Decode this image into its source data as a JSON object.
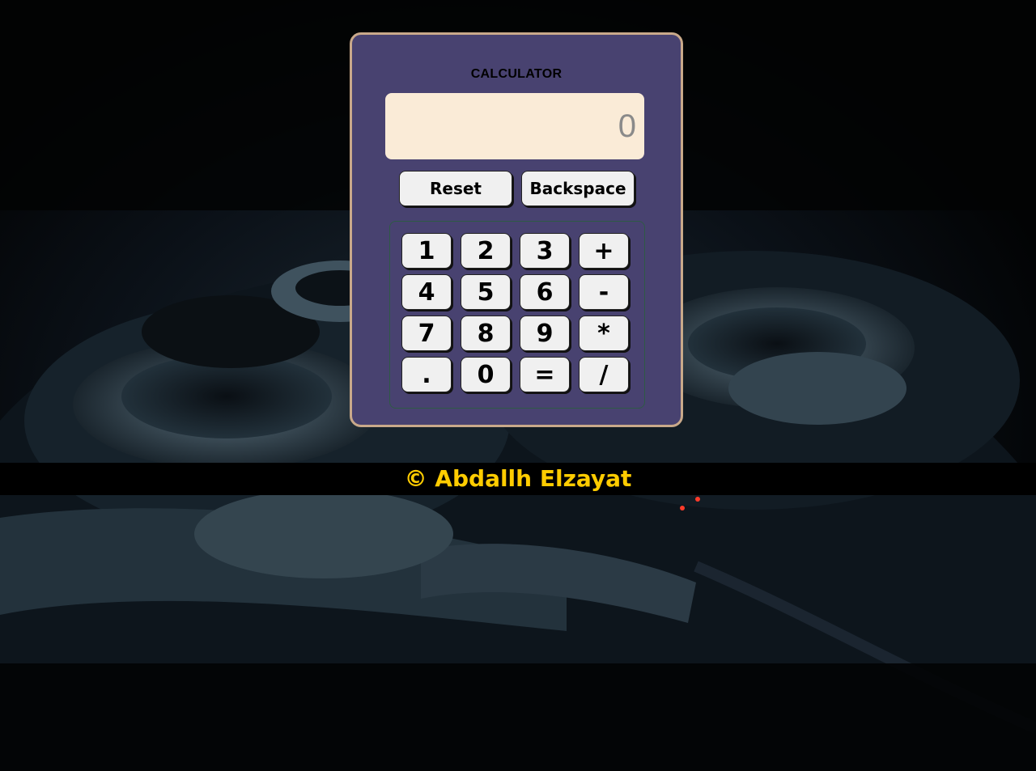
{
  "calculator": {
    "title": "CALCULATOR",
    "display_value": "",
    "display_placeholder": "0",
    "reset_label": "Reset",
    "backspace_label": "Backspace",
    "keys": [
      {
        "label": "1",
        "name": "key-1"
      },
      {
        "label": "2",
        "name": "key-2"
      },
      {
        "label": "3",
        "name": "key-3"
      },
      {
        "label": "+",
        "name": "key-plus"
      },
      {
        "label": "4",
        "name": "key-4"
      },
      {
        "label": "5",
        "name": "key-5"
      },
      {
        "label": "6",
        "name": "key-6"
      },
      {
        "label": "-",
        "name": "key-minus"
      },
      {
        "label": "7",
        "name": "key-7"
      },
      {
        "label": "8",
        "name": "key-8"
      },
      {
        "label": "9",
        "name": "key-9"
      },
      {
        "label": "*",
        "name": "key-multiply"
      },
      {
        "label": ".",
        "name": "key-decimal"
      },
      {
        "label": "0",
        "name": "key-0"
      },
      {
        "label": "=",
        "name": "key-equals"
      },
      {
        "label": "/",
        "name": "key-divide"
      }
    ]
  },
  "footer": {
    "text": "© Abdallh Elzayat"
  },
  "colors": {
    "card": "#484270",
    "card_border": "#c9a98a",
    "display": "#faebd7",
    "button": "#f0f0f0",
    "footer_text": "#ffcc00",
    "footer_bar": "#000000"
  }
}
